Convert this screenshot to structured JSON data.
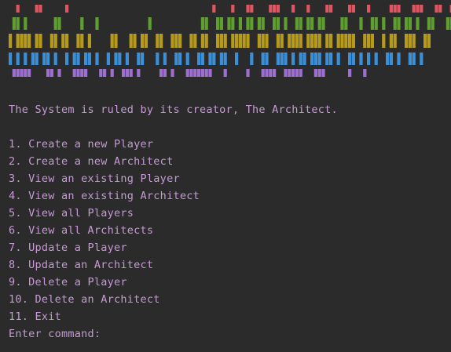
{
  "terminal": {
    "banner": {
      "rows": [
        {
          "color": "#e05561",
          "pattern": "..x....xx......x......................................x....x...xx....xxx...x...x....xx....xx...x.....xxx...xxx...xx..x"
        },
        {
          "color": "#5f9f2f",
          "pattern": ".xx.x.......xx.....x...x.............x.............xx..xx.xx.x.xx.xx..xx.x..xx.xx.xx....xx...x..xx.x..xx.xx.x..xx...xx"
        },
        {
          "color": "#b59a1c",
          "pattern": "x.xxxx.xx..xx.xx..xx.x.....xx...xx.xx..xx..xxx..xx.xx..xxx.xxxxx..xxx..xx.xxxx.xxxx.xx.xxxxx..xxx..x.xx..xxx..xx"
        },
        {
          "color": "#3b8fd6",
          "pattern": "x.x.x.xx.xx.x..x.xx.xx.x..x.xx.x..xx...x.x..xx.x..xx.xx.xx..x...x..xx..xxx.x.xx.xxx.xx.x..xx.x.x.x..xx.x..xx.x"
        },
        {
          "color": "#9c6fd0",
          "pattern": ".xxxxx....xx.x...xxxx...xx.x..xxx.x.....xx.x...xxxxxxx...x.....x...xxxx..xxxxx...xxx......x...x"
        }
      ]
    },
    "intro": "The System is ruled by its creator, The Architect.",
    "menu": [
      "1. Create a new Player",
      "2. Create a new Architect",
      "3. View an existing Player",
      "4. View an existing Architect",
      "5. View all Players",
      "6. View all Architects",
      "7. Update a Player",
      "8. Update an Architect",
      "9. Delete a Player",
      "10. Delete an Architect",
      "11. Exit"
    ],
    "prompt": "Enter command:",
    "text_color": "#c79ad6",
    "background": "#2b2b2b"
  }
}
